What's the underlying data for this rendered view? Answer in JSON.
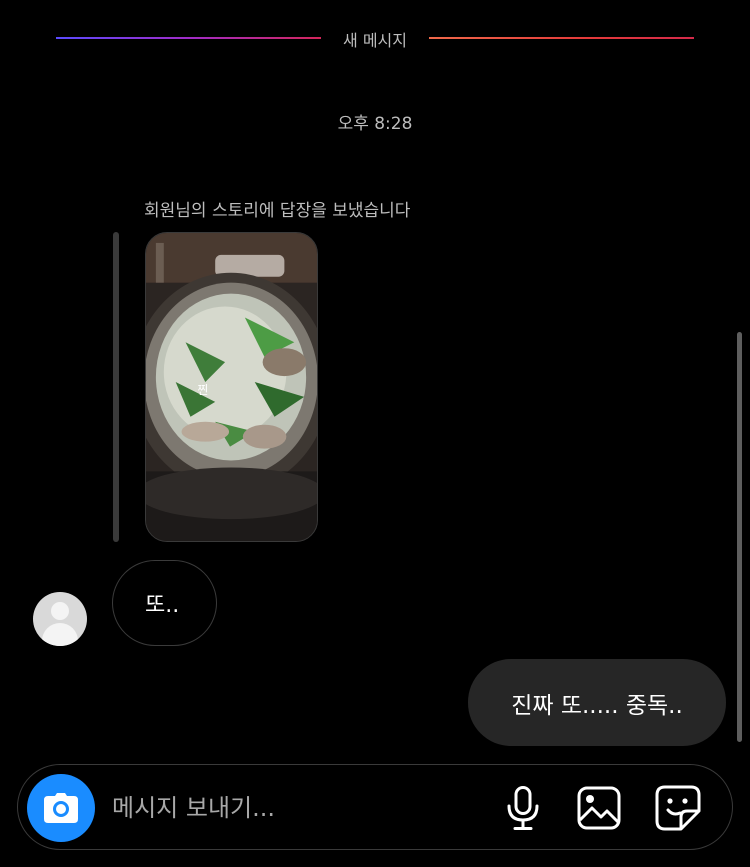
{
  "thread": {
    "new_messages_label": "새 메시지",
    "timestamp": "오후 8:28",
    "story_reply_note": "회원님의 스토리에 답장을 보냈습니다",
    "story_caption": "찐",
    "messages": [
      {
        "direction": "incoming",
        "text": "또.."
      },
      {
        "direction": "outgoing",
        "text": "진짜 또..... 중독.."
      }
    ]
  },
  "composer": {
    "placeholder": "메시지 보내기..."
  },
  "icons": {
    "camera": "camera-icon",
    "microphone": "microphone-icon",
    "gallery": "image-icon",
    "sticker": "sticker-icon"
  },
  "colors": {
    "accent": "#1a8cff",
    "outgoing_bubble": "#262626",
    "background": "#000000"
  }
}
